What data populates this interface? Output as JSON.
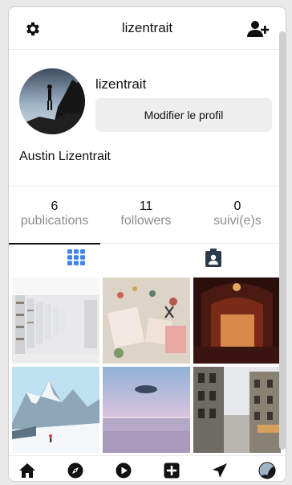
{
  "header": {
    "title": "lizentrait",
    "settings_icon": "gear-icon",
    "add_user_icon": "add-user-icon"
  },
  "profile": {
    "username": "lizentrait",
    "edit_button": "Modifier le profil",
    "full_name": "Austin Lizentrait"
  },
  "stats": [
    {
      "value": "6",
      "label": "publications"
    },
    {
      "value": "11",
      "label": "followers"
    },
    {
      "value": "0",
      "label": "suivi(e)s"
    }
  ],
  "tabs": [
    {
      "icon": "grid-icon",
      "active": true,
      "color": "#3f83f2"
    },
    {
      "icon": "tagged-icon",
      "active": false,
      "color": "#8e8e8e"
    }
  ],
  "posts": [
    {
      "subject": "library shelves"
    },
    {
      "subject": "craft flat-lay"
    },
    {
      "subject": "theater stage"
    },
    {
      "subject": "snowy mountains"
    },
    {
      "subject": "sea at dusk"
    },
    {
      "subject": "city street"
    }
  ],
  "bottom_nav": [
    "home-icon",
    "explore-icon",
    "play-icon",
    "add-post-icon",
    "send-icon",
    "profile-avatar-icon"
  ]
}
